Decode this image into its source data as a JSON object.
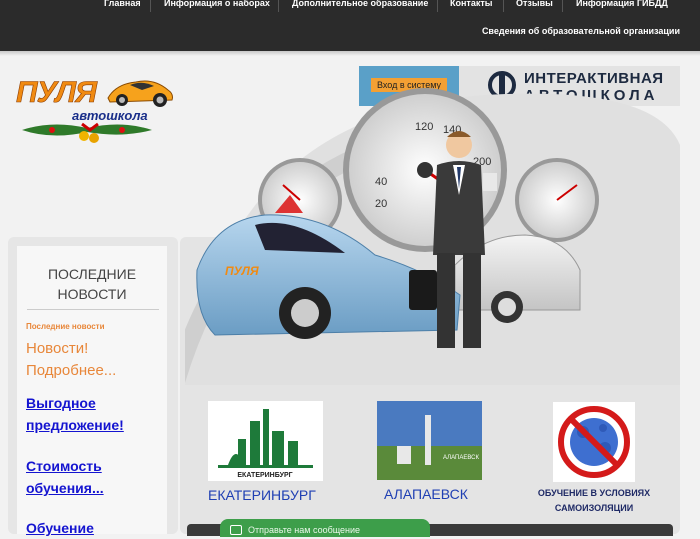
{
  "nav": {
    "items": [
      "Главная",
      "Информация о наборах",
      "Дополнительное образование",
      "Контакты",
      "Отзывы",
      "Информация ГИБДД"
    ],
    "row2": "Сведения об образовательной организации"
  },
  "logo": {
    "main": "ПУЛЯ",
    "sub": "автошкола"
  },
  "banner": {
    "login": "Вход в систему",
    "title1": "ИНТЕРАКТИВНАЯ",
    "title2": "АВТОШКОЛА"
  },
  "sidebar": {
    "title1": "ПОСЛЕДНИЕ",
    "title2": "НОВОСТИ",
    "subtitle": "Последние новости",
    "news1": "Новости!",
    "news2": "Подробнее...",
    "links": [
      "Выгодное",
      "предложение!",
      "Стоимость",
      "обучения...",
      "Обучение"
    ]
  },
  "cities": {
    "ekb_img": "ЕКАТЕРИНБУРГ",
    "ekb": "ЕКАТЕРИНБУРГ",
    "alap": "АЛАПАЕВСК",
    "alap_sign": "АЛАПАЕВСК",
    "covid1": "ОБУЧЕНИЕ В УСЛОВИЯХ",
    "covid2": "САМОИЗОЛЯЦИИ"
  },
  "chat": {
    "text": "Отправьте нам сообщение"
  },
  "colors": {
    "nav_bg": "#2b2b2b",
    "accent_orange": "#e8873a",
    "link_blue": "#1414d0",
    "city_blue": "#1f3fb3"
  }
}
